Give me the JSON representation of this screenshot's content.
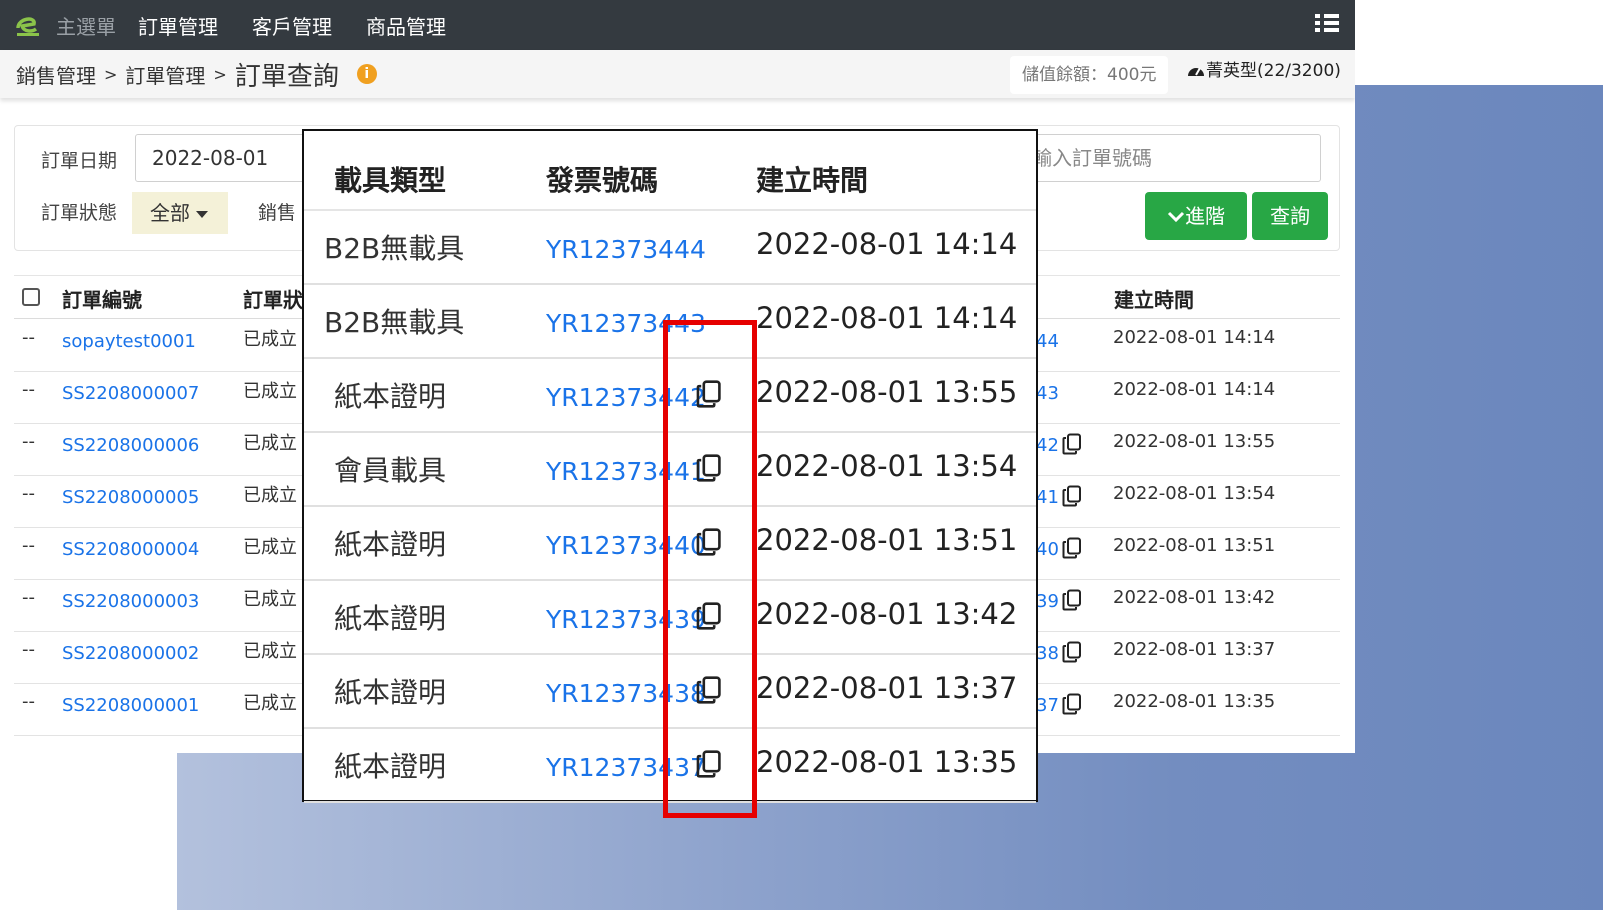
{
  "nav": {
    "home": "主選單",
    "items": [
      "訂單管理",
      "客戶管理",
      "商品管理"
    ]
  },
  "breadcrumb": {
    "level1": "銷售管理",
    "level2": "訂單管理",
    "current": "訂單查詢",
    "sep": ">"
  },
  "account": {
    "balance": "儲值餘額：400元",
    "plan": "菁英型(22/3200)"
  },
  "filters": {
    "date_label": "訂單日期",
    "date_value": "2022-08-01",
    "status_label": "訂單狀態",
    "status_value": "全部",
    "sales_label_partial": "銷售",
    "order_no_placeholder_partial": "輸入訂單號碼",
    "advanced_btn": "進階",
    "search_btn": "查詢"
  },
  "table": {
    "headers": {
      "order_no": "訂單編號",
      "status_partial": "訂單狀",
      "created": "建立時間"
    },
    "rows": [
      {
        "dash": "--",
        "order_no": "sopaytest0001",
        "status": "已成立",
        "inv_tail": "44",
        "created": "2022-08-01 14:14",
        "copy": false
      },
      {
        "dash": "--",
        "order_no": "SS2208000007",
        "status": "已成立",
        "inv_tail": "43",
        "created": "2022-08-01 14:14",
        "copy": false
      },
      {
        "dash": "--",
        "order_no": "SS2208000006",
        "status": "已成立",
        "inv_tail": "42",
        "created": "2022-08-01 13:55",
        "copy": true
      },
      {
        "dash": "--",
        "order_no": "SS2208000005",
        "status": "已成立",
        "inv_tail": "41",
        "created": "2022-08-01 13:54",
        "copy": true
      },
      {
        "dash": "--",
        "order_no": "SS2208000004",
        "status": "已成立",
        "inv_tail": "40",
        "created": "2022-08-01 13:51",
        "copy": true
      },
      {
        "dash": "--",
        "order_no": "SS2208000003",
        "status": "已成立",
        "inv_tail": "39",
        "created": "2022-08-01 13:42",
        "copy": true
      },
      {
        "dash": "--",
        "order_no": "SS2208000002",
        "status": "已成立",
        "inv_tail": "38",
        "created": "2022-08-01 13:37",
        "copy": true
      },
      {
        "dash": "--",
        "order_no": "SS2208000001",
        "status": "已成立",
        "inv_tail": "37",
        "created": "2022-08-01 13:35",
        "copy": true
      }
    ]
  },
  "popup": {
    "headers": {
      "carrier": "載具類型",
      "invoice": "發票號碼",
      "created": "建立時間"
    },
    "rows": [
      {
        "carrier": "B2B無載具",
        "invoice": "YR12373444",
        "created": "2022-08-01 14:14",
        "copy": false
      },
      {
        "carrier": "B2B無載具",
        "invoice": "YR12373443",
        "created": "2022-08-01 14:14",
        "copy": false
      },
      {
        "carrier": "紙本證明",
        "invoice": "YR12373442",
        "created": "2022-08-01 13:55",
        "copy": true
      },
      {
        "carrier": "會員載具",
        "invoice": "YR12373441",
        "created": "2022-08-01 13:54",
        "copy": true
      },
      {
        "carrier": "紙本證明",
        "invoice": "YR12373440",
        "created": "2022-08-01 13:51",
        "copy": true
      },
      {
        "carrier": "紙本證明",
        "invoice": "YR12373439",
        "created": "2022-08-01 13:42",
        "copy": true
      },
      {
        "carrier": "紙本證明",
        "invoice": "YR12373438",
        "created": "2022-08-01 13:37",
        "copy": true
      },
      {
        "carrier": "紙本證明",
        "invoice": "YR12373437",
        "created": "2022-08-01 13:35",
        "copy": true
      }
    ]
  },
  "colors": {
    "accent_green": "#28a745",
    "link_blue": "#1a73e8",
    "highlight_red": "#e60000"
  }
}
